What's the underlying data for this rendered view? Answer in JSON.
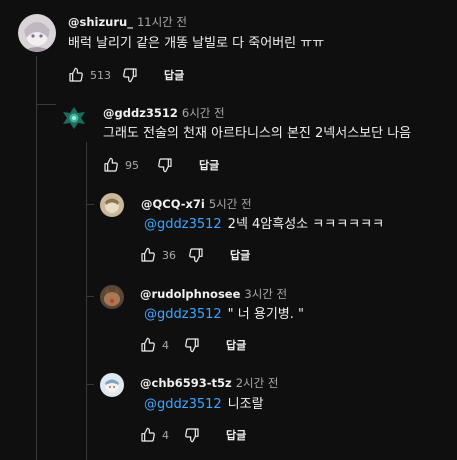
{
  "comments": [
    {
      "handle": "@shizuru_",
      "time": "11시간 전",
      "text": "배럭 날리기 같은 개똥 날빌로 다 죽어버린 ㅠㅠ",
      "likes": "513",
      "reply_label": "답글"
    },
    {
      "handle": "@gddz3512",
      "time": "6시간 전",
      "text": "그래도 전술의 천재 아르타니스의 본진 2넥서스보단 나음",
      "likes": "95",
      "reply_label": "답글"
    },
    {
      "handle": "@QCQ-x7i",
      "time": "5시간 전",
      "mention": "@gddz3512",
      "text": "2넥 4암흑성소 ㅋㅋㅋㅋㅋㅋ",
      "likes": "36",
      "reply_label": "답글"
    },
    {
      "handle": "@rudolphnosee",
      "time": "3시간 전",
      "mention": "@gddz3512",
      "text": "\" 너 용기병. \"",
      "likes": "4",
      "reply_label": "답글"
    },
    {
      "handle": "@chb6593-t5z",
      "time": "2시간 전",
      "mention": "@gddz3512",
      "text": "니조랄",
      "likes": "4",
      "reply_label": "답글"
    }
  ],
  "icons": {
    "like": "thumbs-up-icon",
    "dislike": "thumbs-down-icon"
  },
  "colors": {
    "background": "#0f0f0f",
    "mention": "#3ea6ff",
    "secondary_text": "#aaaaaa",
    "thread_line": "#3a3a3a"
  }
}
